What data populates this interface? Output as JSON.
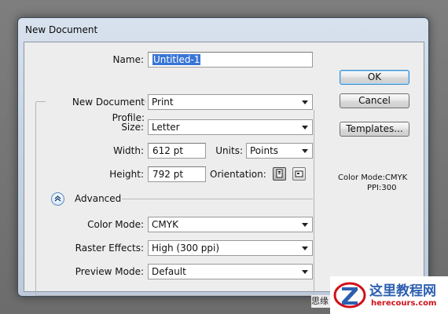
{
  "window": {
    "title": "New Document"
  },
  "form": {
    "name_label": "Name:",
    "name_value": "Untitled-1",
    "profile_label": "New Document Profile:",
    "profile_value": "Print",
    "size_label": "Size:",
    "size_value": "Letter",
    "width_label": "Width:",
    "width_value": "612 pt",
    "units_label": "Units:",
    "units_value": "Points",
    "height_label": "Height:",
    "height_value": "792 pt",
    "orientation_label": "Orientation:",
    "orientation_selected": "portrait",
    "advanced_label": "Advanced",
    "color_mode_label": "Color Mode:",
    "color_mode_value": "CMYK",
    "raster_label": "Raster Effects:",
    "raster_value": "High (300 ppi)",
    "preview_label": "Preview Mode:",
    "preview_value": "Default"
  },
  "buttons": {
    "ok": "OK",
    "cancel": "Cancel",
    "templates": "Templates..."
  },
  "info": {
    "color_mode": "Color Mode:CMYK",
    "ppi": "PPI:300"
  },
  "watermark": {
    "text": "这里教程网",
    "url": "herecours.com",
    "partial_text": "思缘"
  },
  "colors": {
    "selection": "#3875d7",
    "default_button_border": "#3b8fcf",
    "watermark_red": "#d0101a",
    "watermark_blue": "#2d5fb0"
  },
  "icons": {
    "orientation_portrait": "portrait-page-icon",
    "orientation_landscape": "landscape-page-icon",
    "advanced_toggle": "chevron-up-circle-icon",
    "dropdown": "caret-down-icon"
  }
}
